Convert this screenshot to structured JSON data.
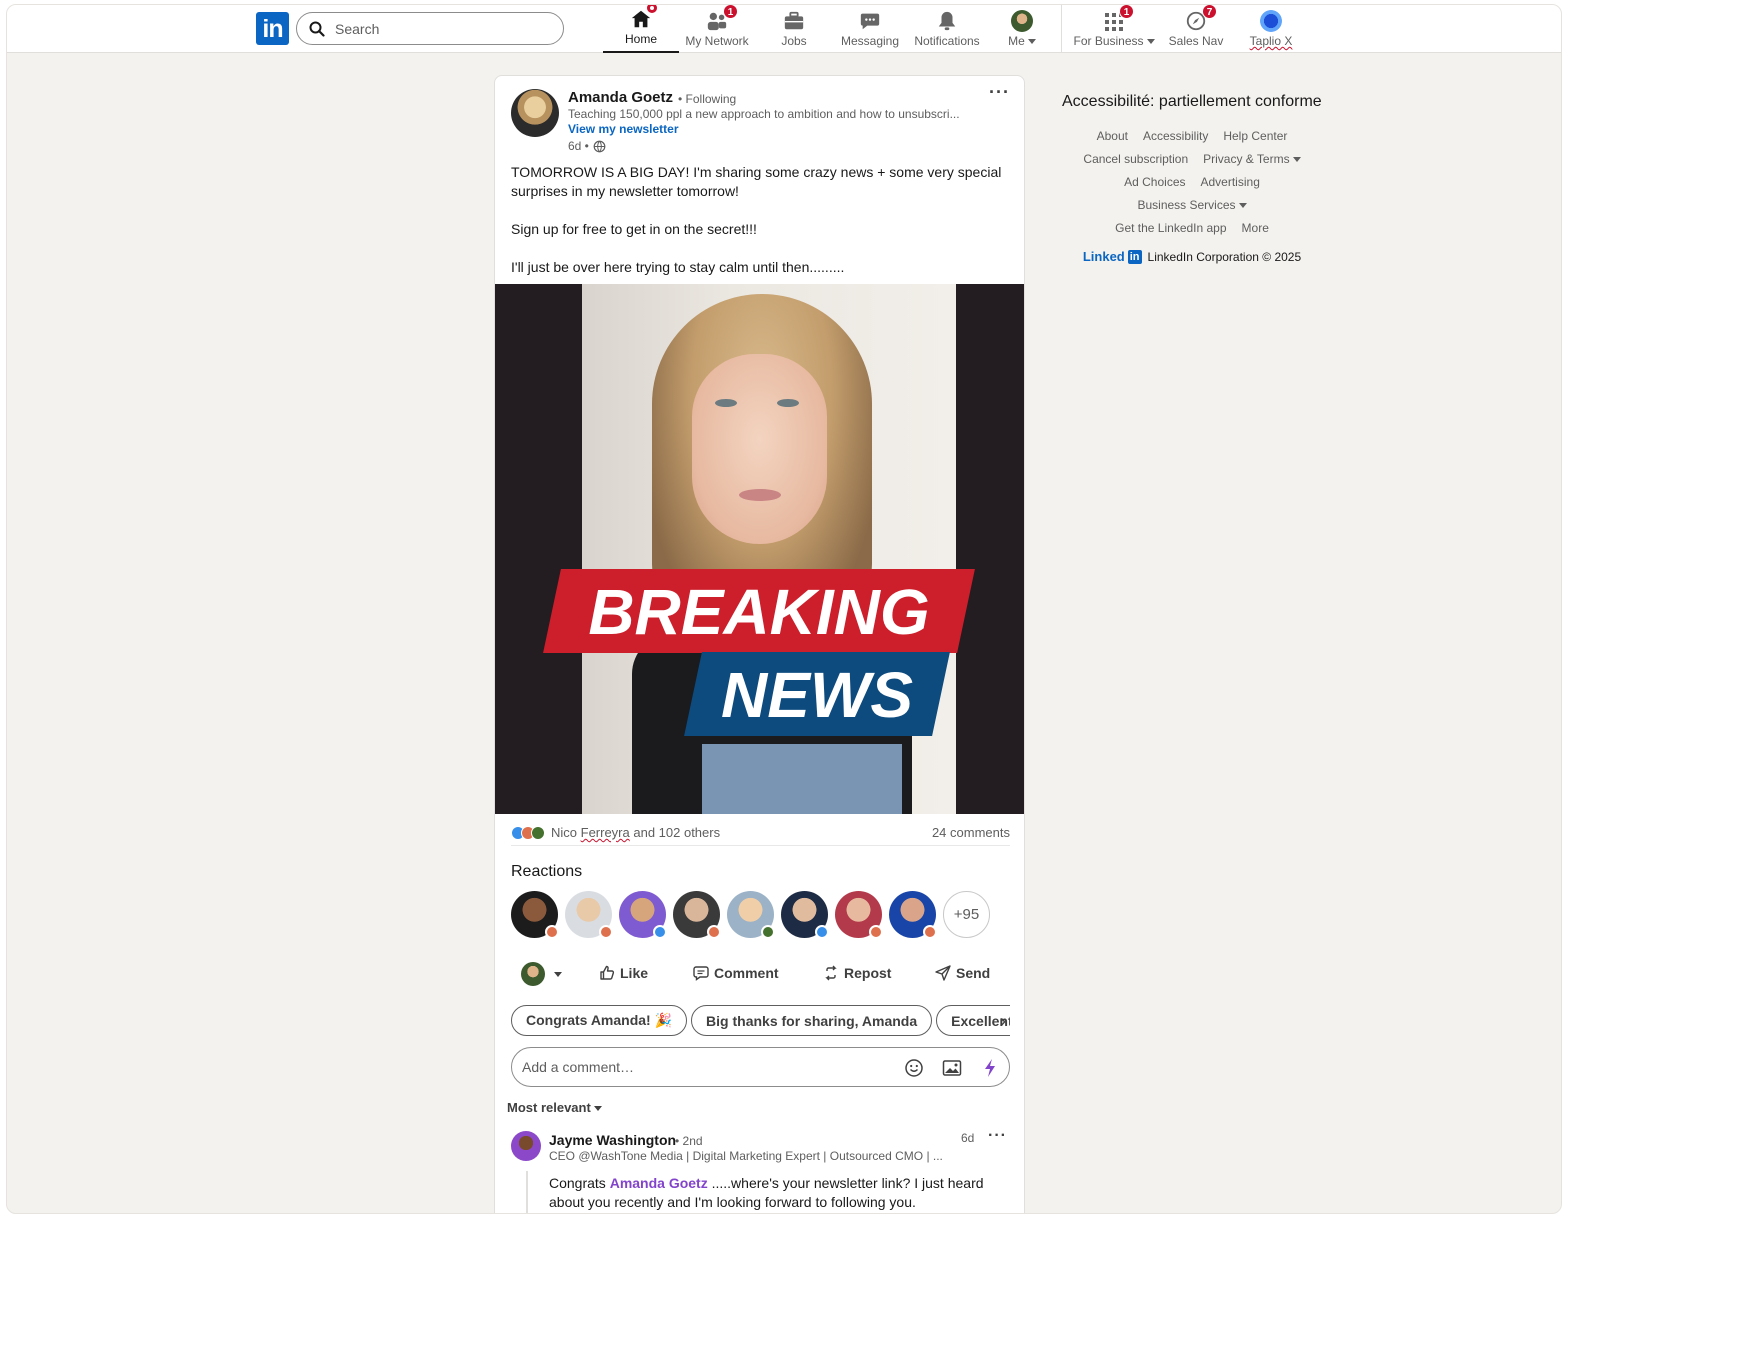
{
  "header": {
    "logo": "in",
    "search_placeholder": "Search",
    "nav": [
      {
        "label": "Home",
        "icon": "home-icon",
        "badge": ""
      },
      {
        "label": "My Network",
        "icon": "network-icon",
        "badge": "1"
      },
      {
        "label": "Jobs",
        "icon": "briefcase-icon",
        "badge": ""
      },
      {
        "label": "Messaging",
        "icon": "chat-icon",
        "badge": ""
      },
      {
        "label": "Notifications",
        "icon": "bell-icon",
        "badge": ""
      },
      {
        "label": "Me",
        "icon": "avatar-icon",
        "badge": ""
      },
      {
        "label": "For Business",
        "icon": "grid-icon",
        "badge": "1"
      },
      {
        "label": "Sales Nav",
        "icon": "compass-icon",
        "badge": "7"
      },
      {
        "label": "Taplio X",
        "icon": "taplio-icon",
        "badge": ""
      }
    ]
  },
  "post": {
    "author": "Amanda Goetz",
    "following": "• Following",
    "headline": "Teaching 150,000 ppl a new approach to ambition and how to unsubscri...",
    "newsletter_link": "View my newsletter",
    "time": "6d •",
    "paragraphs": [
      "TOMORROW IS A BIG DAY! I'm sharing some crazy news + some very special surprises in my newsletter tomorrow!",
      "Sign up for free to get in on the secret!!!",
      "I'll just be over here trying to stay calm until then........."
    ],
    "image_banner_line1": "BREAKING",
    "image_banner_line2": "NEWS",
    "reactions_summary_name": "Nico Ferreyra",
    "reactions_summary_rest": " and 102 others",
    "comments_count": "24 comments",
    "reactions_title": "Reactions",
    "more_reactors": "+95",
    "actions": {
      "like": "Like",
      "comment": "Comment",
      "repost": "Repost",
      "send": "Send"
    },
    "suggestions": [
      "Congrats Amanda! 🎉",
      "Big thanks for sharing, Amanda",
      "Excellent"
    ],
    "comment_placeholder": "Add a comment…",
    "sort_label": "Most relevant"
  },
  "comment": {
    "name": "Jayme Washington",
    "degree": "• 2nd",
    "headline": "CEO @WashTone Media | Digital Marketing Expert | Outsourced CMO | ...",
    "time": "6d",
    "text_before": "Congrats ",
    "mention": "Amanda Goetz",
    "text_after": " .....where's your newsletter link? I just heard about you recently and I'm looking forward to following you."
  },
  "rail": {
    "accessibility": "Accessibilité: partiellement conforme",
    "links": {
      "about": "About",
      "accessibility": "Accessibility",
      "help": "Help Center",
      "cancel": "Cancel subscription",
      "privacy": "Privacy & Terms",
      "adchoices": "Ad Choices",
      "advertising": "Advertising",
      "business": "Business Services",
      "app": "Get the LinkedIn app",
      "more": "More"
    },
    "brand_word": "Linked",
    "brand_in": "in",
    "copyright": "LinkedIn Corporation © 2025"
  },
  "colors": {
    "brand": "#0a66c2",
    "badge": "#cb112d",
    "mention": "#8344cc",
    "banner_red": "#cc1f2b",
    "banner_blue": "#0d4a7e"
  }
}
